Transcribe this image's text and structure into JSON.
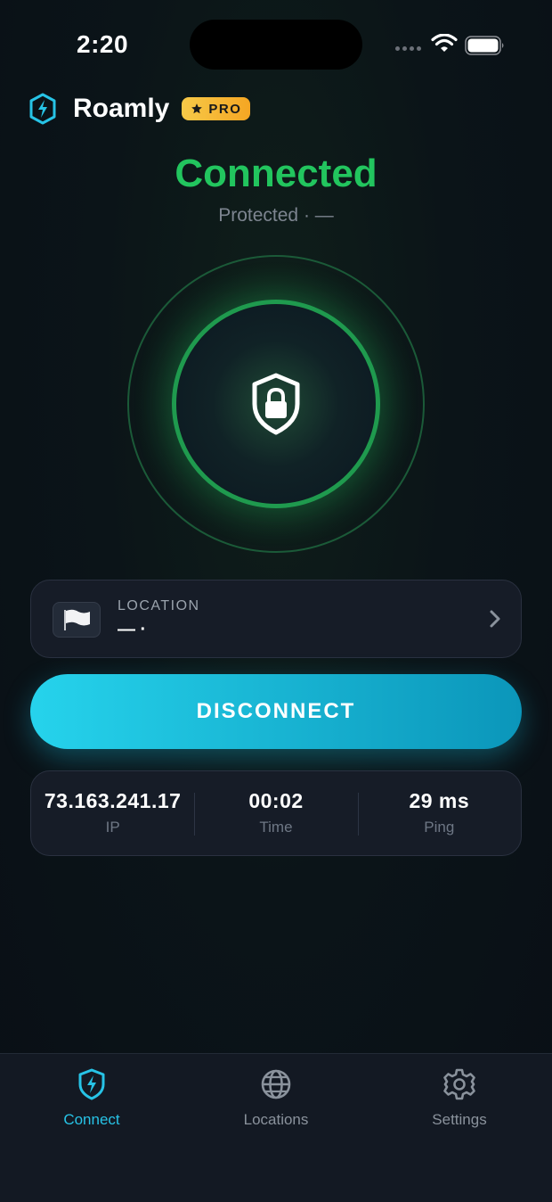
{
  "status_bar": {
    "time": "2:20"
  },
  "header": {
    "app_name": "Roamly",
    "badge": "PRO",
    "badge_icon": "star-icon"
  },
  "connection": {
    "status": "Connected",
    "subtitle": "Protected · —",
    "status_color": "#22c55e",
    "center_icon": "shield-lock-icon"
  },
  "location": {
    "label": "LOCATION",
    "value": "— ·",
    "flag_icon": "white-flag-icon"
  },
  "action": {
    "button_label": "DISCONNECT",
    "accent": "#16b6d6"
  },
  "stats": [
    {
      "value": "73.163.241.17",
      "label": "IP"
    },
    {
      "value": "00:02",
      "label": "Time"
    },
    {
      "value": "29 ms",
      "label": "Ping"
    }
  ],
  "tabs": [
    {
      "label": "Connect",
      "icon": "bolt-shield-icon",
      "active": true
    },
    {
      "label": "Locations",
      "icon": "globe-icon",
      "active": false
    },
    {
      "label": "Settings",
      "icon": "gear-icon",
      "active": false
    }
  ],
  "colors": {
    "tab_active": "#27c3e6",
    "tab_inactive": "#8a929c"
  }
}
